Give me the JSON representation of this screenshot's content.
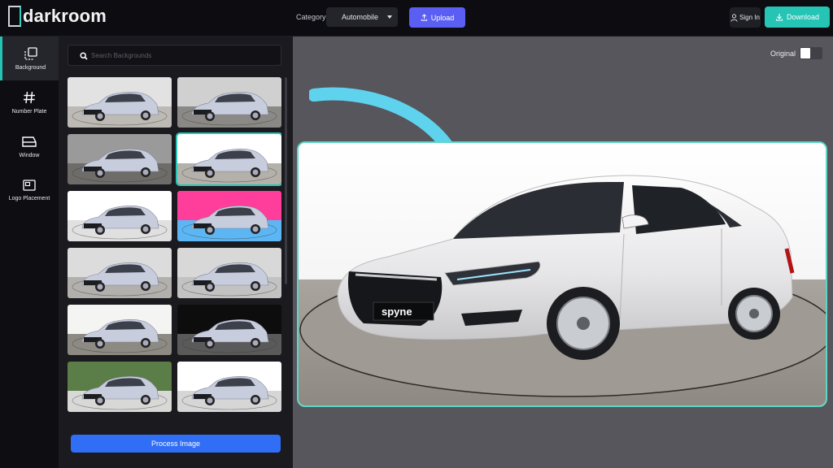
{
  "app": {
    "title": "darkroom",
    "category_label": "Category:",
    "category_value": "Automobile",
    "upload_label": "Upload",
    "signin_label": "Sign In",
    "download_label": "Download",
    "accent": "#26c4b5",
    "upload_color": "#5b5ef2"
  },
  "rail": {
    "items": [
      {
        "label": "Background",
        "icon": "background-icon",
        "active": true
      },
      {
        "label": "Number Plate",
        "icon": "hash-icon",
        "active": false
      },
      {
        "label": "Window",
        "icon": "window-icon",
        "active": false
      },
      {
        "label": "Logo Placement",
        "icon": "logo-placement-icon",
        "active": false
      }
    ]
  },
  "panel": {
    "search_placeholder": "Search Backgrounds",
    "process_label": "Process Image",
    "backgrounds": [
      {
        "bg": "studio-gray-floor"
      },
      {
        "bg": "studio-turntable-gray"
      },
      {
        "bg": "studio-dark-gradient"
      },
      {
        "bg": "white-turntable",
        "selected": true
      },
      {
        "bg": "white-studio"
      },
      {
        "bg": "pink-blue-gradient"
      },
      {
        "bg": "gray-studio-floor"
      },
      {
        "bg": "light-gray-studio"
      },
      {
        "bg": "concrete-white-wall"
      },
      {
        "bg": "black-spotlight"
      },
      {
        "bg": "hedge-outdoor"
      },
      {
        "bg": "white-floor"
      }
    ]
  },
  "canvas": {
    "original_label": "Original",
    "original_toggle": false,
    "plate_text": "spyne"
  }
}
